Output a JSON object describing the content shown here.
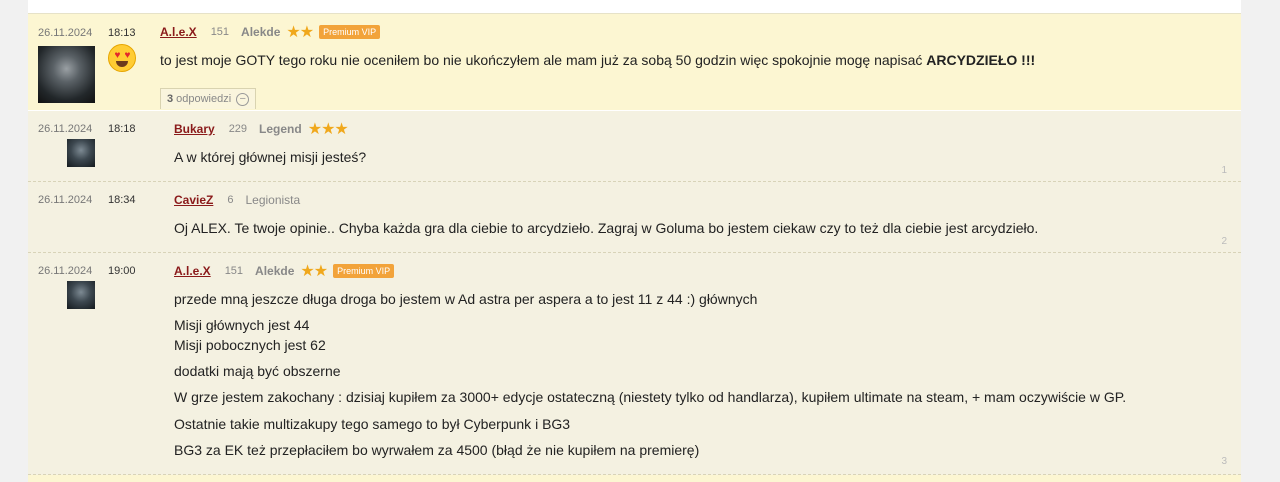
{
  "main_post": {
    "date": "26.11.2024",
    "time": "18:13",
    "nick": "A.l.e.X",
    "post_count": "151",
    "rank": "Alekde",
    "stars": "★★",
    "badge": "Premium VIP",
    "text_before": "to jest moje GOTY tego roku nie oceniłem bo nie ukończyłem ale mam już za sobą 50 godzin więc spokojnie mogę napisać ",
    "text_bold": "ARCYDZIEŁO !!!",
    "replies_count": "3",
    "replies_label": "odpowiedzi"
  },
  "replies": [
    {
      "date": "26.11.2024",
      "time": "18:18",
      "nick": "Bukary",
      "post_count": "229",
      "rank": "Legend",
      "stars": "★★★",
      "lines": [
        "A w której głównej misji jesteś?"
      ],
      "number": "1"
    },
    {
      "date": "26.11.2024",
      "time": "18:34",
      "nick": "CavieZ",
      "post_count": "6",
      "rank": "Legionista",
      "lines": [
        "Oj ALEX. Te twoje opinie.. Chyba każda gra dla ciebie to arcydzieło. Zagraj w Goluma bo jestem ciekaw czy to też dla ciebie jest arcydzieło."
      ],
      "number": "2"
    },
    {
      "date": "26.11.2024",
      "time": "19:00",
      "nick": "A.l.e.X",
      "post_count": "151",
      "rank": "Alekde",
      "stars": "★★",
      "badge": "Premium VIP",
      "lines": [
        "przede mną jeszcze długa droga bo jestem w Ad astra per aspera a to jest 11 z 44 :) głównych",
        "Misji głównych jest 44",
        "Misji pobocznych jest 62",
        "dodatki mają być obszerne",
        "W grze jestem zakochany : dzisiaj kupiłem za 3000+ edycje ostateczną (niestety tylko od handlarza), kupiłem ultimate na steam, + mam oczywiście w GP.",
        "Ostatnie takie multizakupy tego samego to był Cyberpunk i BG3",
        "BG3 za EK też przepłaciłem bo wyrwałem za 4500 (błąd że nie kupiłem na premierę)"
      ],
      "number": "3"
    }
  ],
  "colors": {
    "main_bg": "#fcf6d2",
    "reply_bg": "#f4f1e1",
    "nick": "#8a1a1a",
    "star": "#f0a81c",
    "vip_badge": "#f2a33a"
  }
}
